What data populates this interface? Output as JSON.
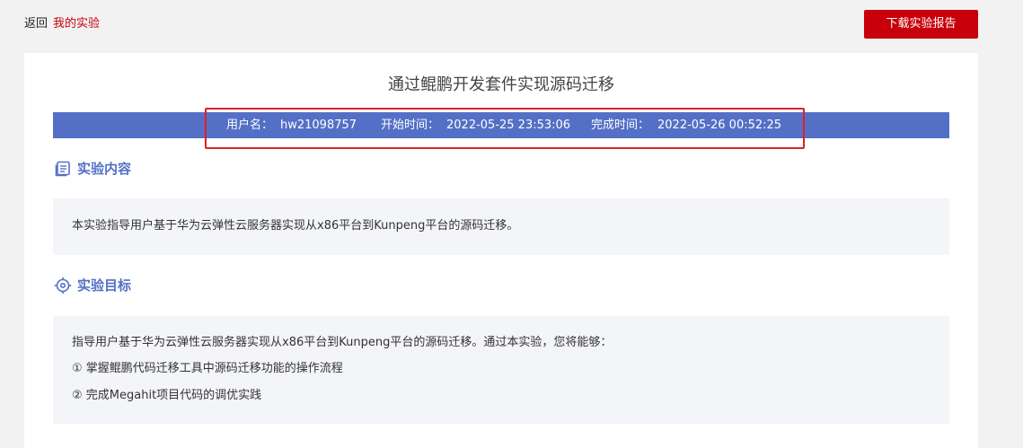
{
  "header": {
    "back_label": "返回",
    "breadcrumb_current": "我的实验",
    "download_button": "下载实验报告"
  },
  "experiment": {
    "title": "通过鲲鹏开发套件实现源码迁移",
    "info": {
      "username_label": "用户名：",
      "username": "hw21098757",
      "start_label": "开始时间：",
      "start_time": "2022-05-25 23:53:06",
      "finish_label": "完成时间：",
      "finish_time": "2022-05-26 00:52:25"
    }
  },
  "sections": {
    "content": {
      "icon": "document-icon",
      "heading": "实验内容",
      "text": "本实验指导用户基于华为云弹性云服务器实现从x86平台到Kunpeng平台的源码迁移。"
    },
    "goals": {
      "icon": "target-icon",
      "heading": "实验目标",
      "intro": "指导用户基于华为云弹性云服务器实现从x86平台到Kunpeng平台的源码迁移。通过本实验，您将能够：",
      "items": [
        "① 掌握鲲鹏代码迁移工具中源码迁移功能的操作流程",
        "② 完成Megahit项目代码的调优实践"
      ]
    }
  },
  "colors": {
    "brand_red": "#c7000b",
    "info_bar_blue": "#5470c6",
    "highlight_red": "#e02020",
    "panel_bg": "#f4f5f9"
  }
}
